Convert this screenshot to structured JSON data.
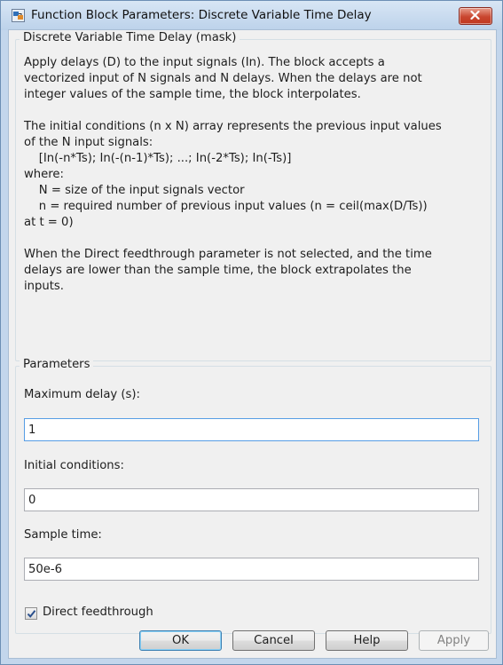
{
  "window": {
    "title": "Function Block Parameters: Discrete Variable Time Delay"
  },
  "description": {
    "heading": "Discrete Variable Time Delay (mask)",
    "lines": [
      "Apply delays (D) to the input signals (In). The block accepts a",
      "vectorized input of N signals and N delays. When the delays are not",
      "integer values of the sample time, the block interpolates.",
      "",
      "The initial conditions (n x N) array represents the previous input values",
      "of the N input signals:",
      "    [In(-n*Ts); In(-(n-1)*Ts); ...; In(-2*Ts); In(-Ts)]",
      "where:",
      "    N = size of the input signals vector",
      "    n = required number of previous input values (n = ceil(max(D/Ts))",
      "at t = 0)",
      "",
      "When the Direct feedthrough parameter is not selected, and the time",
      "delays are lower than the sample time, the block extrapolates the",
      "inputs."
    ]
  },
  "parameters": {
    "heading": "Parameters",
    "max_delay_label": "Maximum delay (s):",
    "max_delay_value": "1",
    "initial_conditions_label": "Initial conditions:",
    "initial_conditions_value": "0",
    "sample_time_label": "Sample time:",
    "sample_time_value": "50e-6",
    "direct_feedthrough_label": "Direct feedthrough",
    "direct_feedthrough_checked": true
  },
  "buttons": {
    "ok": "OK",
    "cancel": "Cancel",
    "help": "Help",
    "apply": "Apply"
  },
  "icons": {
    "app": "simulink-block-icon",
    "close": "close-icon",
    "check": "checkmark-icon"
  },
  "colors": {
    "title_bar": "#c3d6ec",
    "close_button": "#c9462f",
    "focus_border": "#569de5"
  }
}
